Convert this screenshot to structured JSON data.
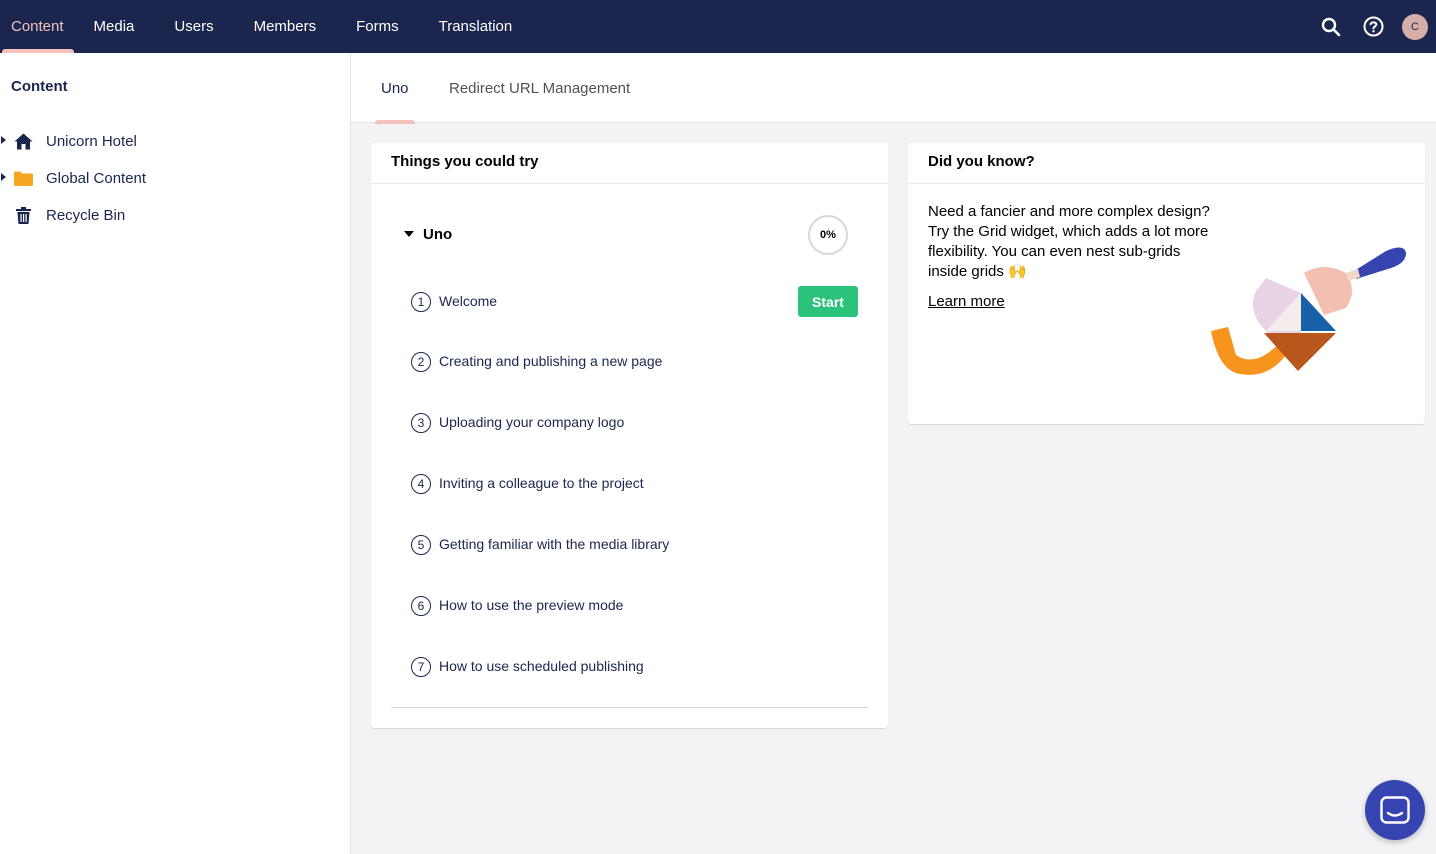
{
  "topbar": {
    "sections": [
      {
        "label": "Content",
        "active": true
      },
      {
        "label": "Media",
        "active": false
      },
      {
        "label": "Users",
        "active": false
      },
      {
        "label": "Members",
        "active": false
      },
      {
        "label": "Forms",
        "active": false
      },
      {
        "label": "Translation",
        "active": false
      }
    ],
    "icons": [
      "search-icon",
      "help-icon"
    ],
    "user_initial": "C"
  },
  "sidebar": {
    "title": "Content",
    "tree": [
      {
        "label": "Unicorn Hotel",
        "icon": "home-icon",
        "expandable": true
      },
      {
        "label": "Global Content",
        "icon": "folder-icon",
        "expandable": true
      },
      {
        "label": "Recycle Bin",
        "icon": "trash-icon",
        "expandable": false
      }
    ]
  },
  "tabs": [
    {
      "label": "Uno",
      "active": true
    },
    {
      "label": "Redirect URL Management",
      "active": false
    }
  ],
  "tours_card": {
    "title": "Things you could try",
    "group_label": "Uno",
    "progress": "0%",
    "steps": [
      {
        "num": "1",
        "label": "Welcome",
        "action": "Start"
      },
      {
        "num": "2",
        "label": "Creating and publishing a new page"
      },
      {
        "num": "3",
        "label": "Uploading your company logo"
      },
      {
        "num": "4",
        "label": "Inviting a colleague to the project"
      },
      {
        "num": "5",
        "label": "Getting familiar with the media library"
      },
      {
        "num": "6",
        "label": "How to use the preview mode"
      },
      {
        "num": "7",
        "label": "How to use scheduled publishing"
      }
    ]
  },
  "dyk_card": {
    "title": "Did you know?",
    "text": "Need a fancier and more complex design? Try the Grid widget, which adds a lot more flexibility. You can even nest sub-grids inside grids 🙌",
    "link": "Learn more"
  },
  "colors": {
    "topbar": "#1b264f",
    "accent": "#f5c1bc",
    "start_button": "#2bc37c",
    "help_bubble": "#3544b1",
    "folder": "#f5a623"
  }
}
